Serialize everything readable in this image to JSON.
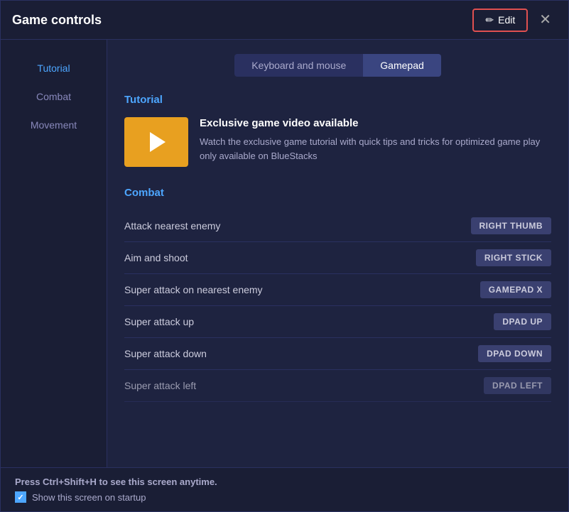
{
  "window": {
    "title": "Game controls"
  },
  "title_bar": {
    "edit_label": "Edit",
    "close_label": "✕"
  },
  "sidebar": {
    "items": [
      {
        "label": "Tutorial",
        "active": true
      },
      {
        "label": "Combat",
        "active": false
      },
      {
        "label": "Movement",
        "active": false
      }
    ]
  },
  "tabs": [
    {
      "label": "Keyboard and mouse",
      "active": false
    },
    {
      "label": "Gamepad",
      "active": true
    }
  ],
  "tutorial_section": {
    "title": "Tutorial",
    "video_title": "Exclusive game video available",
    "video_description": "Watch the exclusive game tutorial with quick tips and tricks for optimized game play only available on BlueStacks"
  },
  "combat_section": {
    "title": "Combat",
    "controls": [
      {
        "label": "Attack nearest enemy",
        "badge": "RIGHT THUMB"
      },
      {
        "label": "Aim and shoot",
        "badge": "RIGHT STICK"
      },
      {
        "label": "Super attack on nearest enemy",
        "badge": "GAMEPAD X"
      },
      {
        "label": "Super attack up",
        "badge": "DPAD UP"
      },
      {
        "label": "Super attack down",
        "badge": "DPAD DOWN"
      },
      {
        "label": "Super attack left",
        "badge": "DPAD LEFT"
      }
    ]
  },
  "footer": {
    "hint": "Press Ctrl+Shift+H to see this screen anytime.",
    "checkbox_label": "Show this screen on startup"
  }
}
